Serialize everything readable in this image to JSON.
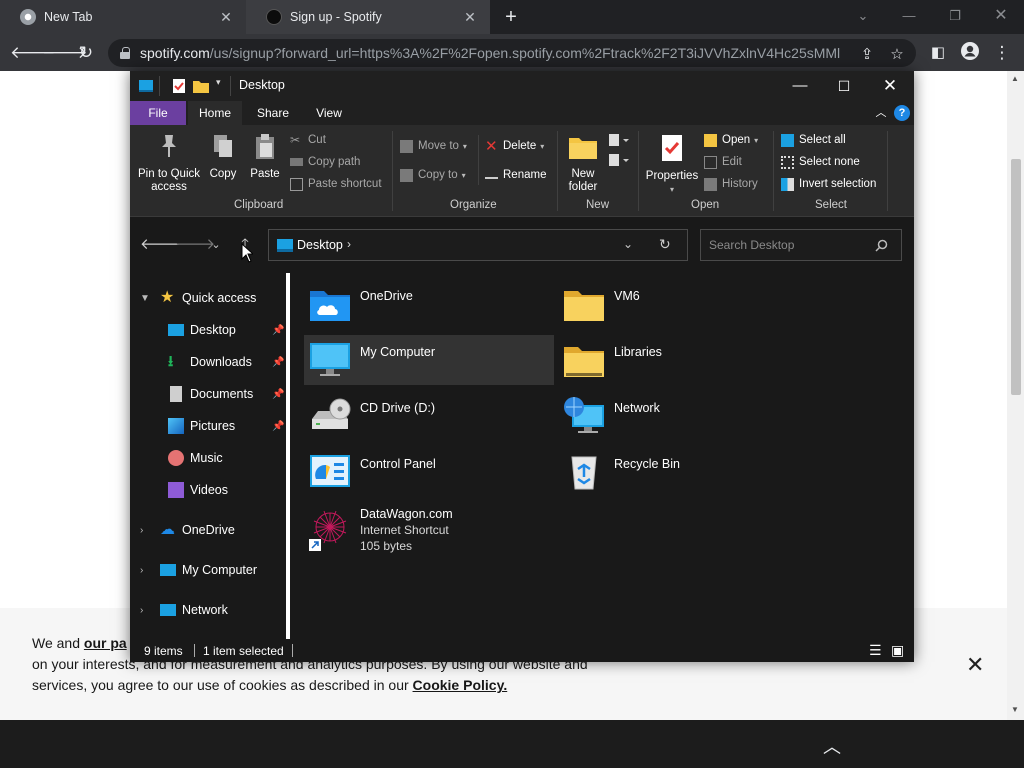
{
  "browser": {
    "tabs": [
      {
        "title": "New Tab",
        "close": "✕"
      },
      {
        "title": "Sign up - Spotify",
        "close": "✕"
      }
    ],
    "new_tab": "+",
    "url_host": "spotify.com",
    "url_rest": "/us/signup?forward_url=https%3A%2F%2Fopen.spotify.com%2Ftrack%2F2T3iJVVhZxlnV4Hc25sMMl..."
  },
  "cookie_banner": {
    "line1_prefix": "We and ",
    "line1_link": "our pa",
    "line2": "on your interests, and for measurement and analytics purposes. By using our website and",
    "line3_prefix": "services, you agree to our use of cookies as described in our ",
    "line3_link": "Cookie Policy."
  },
  "explorer": {
    "title": "Desktop",
    "ribbon_tabs": [
      "File",
      "Home",
      "Share",
      "View"
    ],
    "groups": {
      "clipboard": {
        "label": "Clipboard",
        "pin": "Pin to Quick access",
        "copy": "Copy",
        "paste": "Paste",
        "cut": "Cut",
        "copy_path": "Copy path",
        "paste_shortcut": "Paste shortcut"
      },
      "organize": {
        "label": "Organize",
        "move_to": "Move to",
        "copy_to": "Copy to",
        "delete": "Delete",
        "rename": "Rename"
      },
      "new": {
        "label": "New",
        "new_folder": "New folder"
      },
      "open": {
        "label": "Open",
        "properties": "Properties",
        "open": "Open",
        "edit": "Edit",
        "history": "History"
      },
      "select": {
        "label": "Select",
        "select_all": "Select all",
        "select_none": "Select none",
        "invert": "Invert selection"
      }
    },
    "address": {
      "path": "Desktop",
      "search_placeholder": "Search Desktop"
    },
    "nav_pane": {
      "quick_access": "Quick access",
      "quick_items": [
        "Desktop",
        "Downloads",
        "Documents",
        "Pictures",
        "Music",
        "Videos"
      ],
      "onedrive": "OneDrive",
      "my_computer": "My Computer",
      "network": "Network"
    },
    "items": [
      {
        "name": "OneDrive"
      },
      {
        "name": "VM6"
      },
      {
        "name": "My Computer"
      },
      {
        "name": "Libraries"
      },
      {
        "name": "CD Drive (D:)"
      },
      {
        "name": "Network"
      },
      {
        "name": "Control Panel"
      },
      {
        "name": "Recycle Bin"
      },
      {
        "name": "DataWagon.com",
        "type": "Internet Shortcut",
        "size": "105 bytes"
      }
    ],
    "status": {
      "count": "9 items",
      "selected": "1 item selected"
    }
  },
  "colors": {
    "file_tab": "#6b3fa0",
    "explorer_bg": "#191919",
    "ribbon_bg": "#2b2b2b",
    "folder_yellow": "#f4c542",
    "accent_blue": "#1ba1e2"
  }
}
